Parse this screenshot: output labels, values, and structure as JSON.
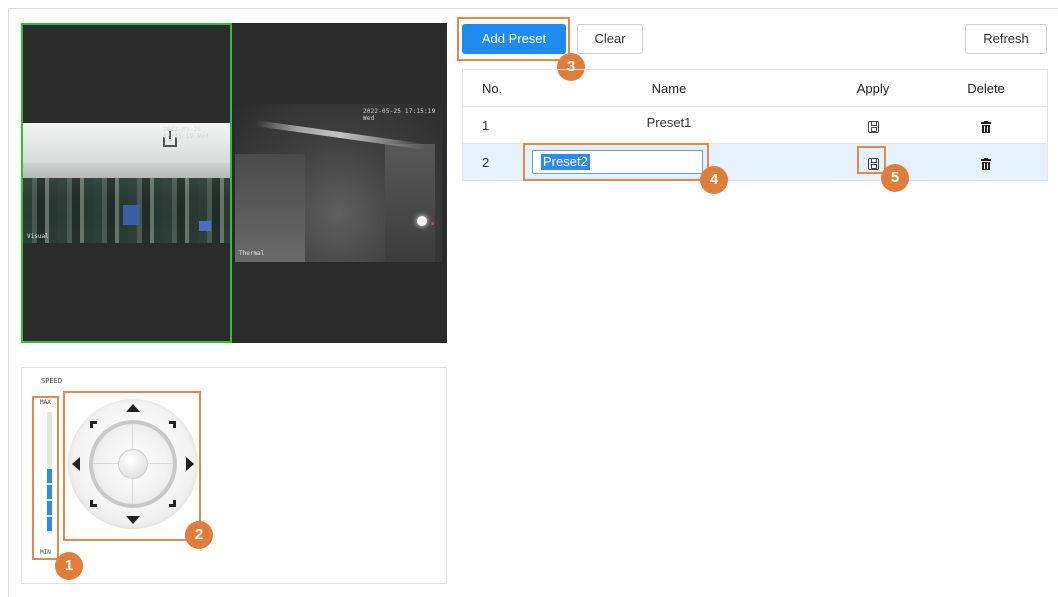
{
  "video": {
    "left_timestamp": "2022-05-25 17:15:19 Wed",
    "left_osd": "Visual",
    "right_timestamp": "2022-05-25 17:15:19 Wed",
    "right_osd": "Thermal"
  },
  "ptz": {
    "speed_label": "SPEED",
    "max_label": "MAX",
    "min_label": "MIN",
    "speed_level_fraction": 0.5
  },
  "toolbar": {
    "add_preset_label": "Add Preset",
    "clear_label": "Clear",
    "refresh_label": "Refresh"
  },
  "table": {
    "headers": {
      "no": "No.",
      "name": "Name",
      "apply": "Apply",
      "delete": "Delete"
    },
    "rows": [
      {
        "no": "1",
        "name": "Preset1"
      },
      {
        "no": "2",
        "name": "Preset2"
      }
    ]
  },
  "callouts": [
    "1",
    "2",
    "3",
    "4",
    "5"
  ],
  "colors": {
    "primary": "#1f8bf0",
    "callout": "#e17d3a",
    "selected_row": "#e5f2fd",
    "active_border": "#2fbf3a"
  }
}
